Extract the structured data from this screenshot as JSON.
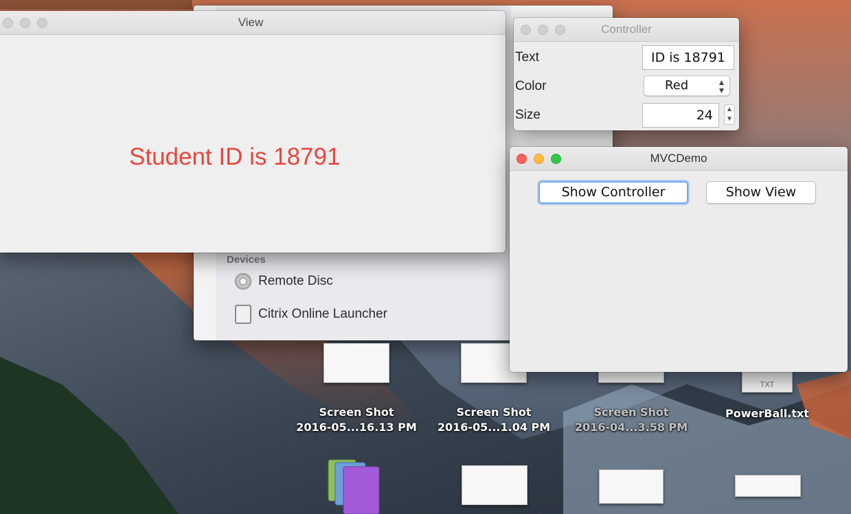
{
  "view_window": {
    "title": "View",
    "label_text": "Student ID is 18791",
    "label_color": "#e8463c"
  },
  "controller_window": {
    "title": "Controller",
    "rows": {
      "text": {
        "label": "Text",
        "value": "ID is 18791"
      },
      "color": {
        "label": "Color",
        "value": "Red"
      },
      "size": {
        "label": "Size",
        "value": "24"
      }
    }
  },
  "mvc_window": {
    "title": "MVCDemo",
    "show_controller_label": "Show Controller",
    "show_view_label": "Show View"
  },
  "finder": {
    "section_devices": "Devices",
    "items": [
      {
        "label": "Remote Disc",
        "icon": "disc-icon"
      },
      {
        "label": "Citrix Online Launcher",
        "icon": "drive-icon"
      }
    ]
  },
  "desktop_icons": [
    {
      "line1": "Screen Shot",
      "line2": "2016-05...16.13 PM"
    },
    {
      "line1": "Screen Shot",
      "line2": "2016-05...1.04 PM"
    },
    {
      "line1": "Screen Shot",
      "line2": "2016-04...3.58 PM"
    },
    {
      "line1": "PowerBall.txt",
      "line2": ""
    }
  ],
  "txt_badge": "TXT",
  "accent_color": "#76a7ef"
}
